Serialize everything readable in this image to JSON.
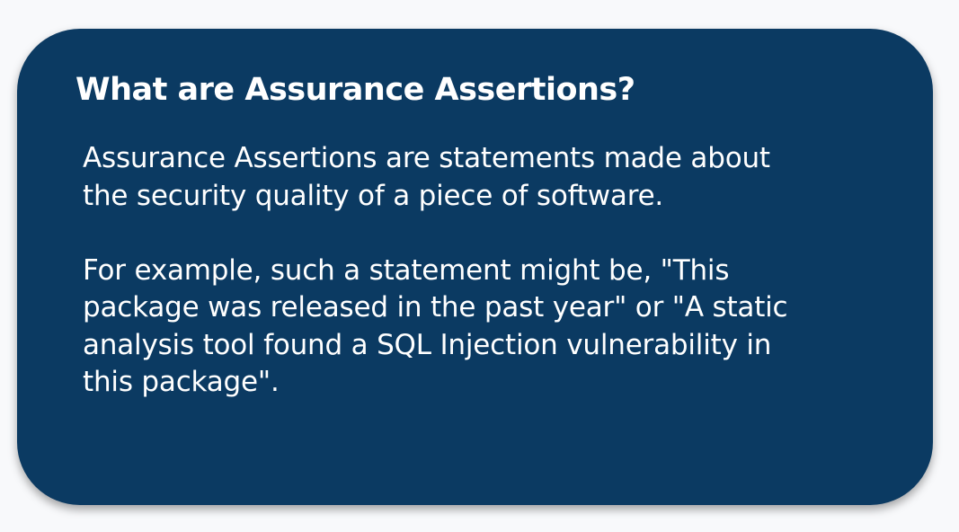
{
  "card": {
    "title": "What are Assurance Assertions?",
    "paragraph_1": {
      "lines": [
        "Assurance Assertions are statements made about",
        "the security quality of a piece of software."
      ]
    },
    "paragraph_2": {
      "lines": [
        "For example, such a statement might be, \"This",
        "package was released in the past year\" or \"A static",
        "analysis tool found a SQL Injection vulnerability in",
        "this package\"."
      ]
    }
  },
  "colors": {
    "card_background": "#0b3a62",
    "text": "#ffffff",
    "page_background": "#f8f9fb"
  }
}
